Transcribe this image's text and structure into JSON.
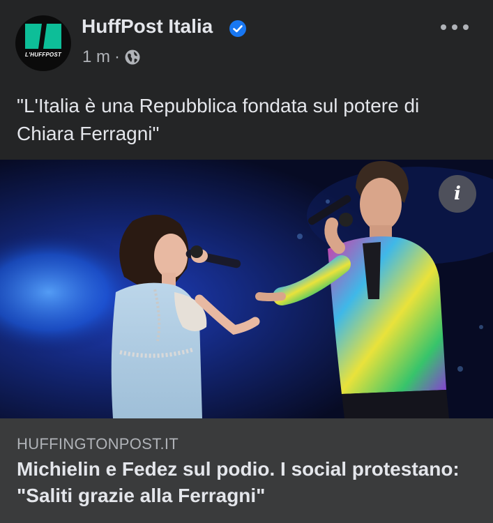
{
  "post": {
    "page_name": "HuffPost Italia",
    "avatar_text": "L'HUFFPOST",
    "timestamp": "1 m",
    "separator": "·",
    "audience_icon": "globe-icon",
    "verified_icon": "verified-badge-icon",
    "more_icon": "more-options-icon",
    "caption": "\"L'Italia è una Repubblica fondata sul potere di Chiara Ferragni\""
  },
  "image": {
    "info_label": "i"
  },
  "link": {
    "domain": "HUFFINGTONPOST.IT",
    "headline": "Michielin e Fedez sul podio. I social protestano: \"Saliti grazie alla Ferragni\""
  },
  "colors": {
    "background": "#242526",
    "link_preview_bg": "#3a3b3c",
    "primary_text": "#e4e6eb",
    "secondary_text": "#b0b3b8",
    "verified_blue": "#1877f2",
    "brand_green": "#0dbe98"
  }
}
